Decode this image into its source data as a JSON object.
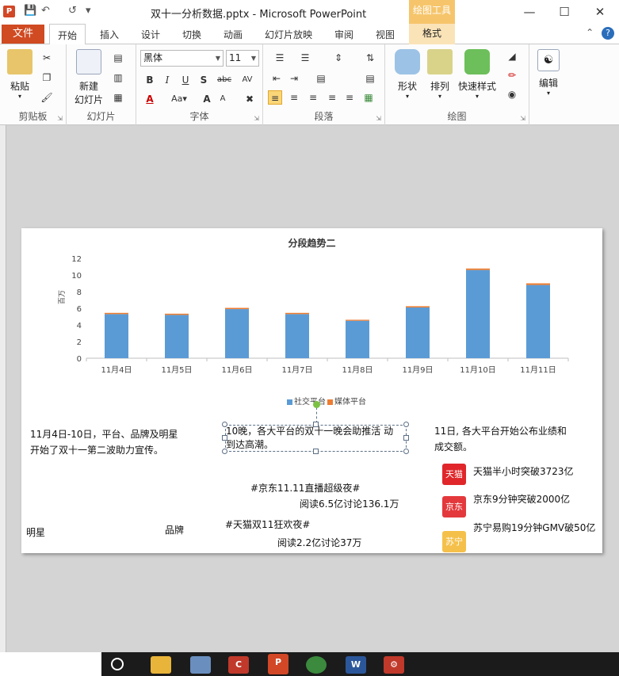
{
  "window": {
    "title": "双十一分析数据.pptx - Microsoft PowerPoint",
    "context_tab_header": "绘图工具"
  },
  "tabs": {
    "file": "文件",
    "items": [
      "开始",
      "插入",
      "设计",
      "切换",
      "动画",
      "幻灯片放映",
      "审阅",
      "视图"
    ],
    "context": "格式"
  },
  "ribbon": {
    "clipboard": {
      "paste": "粘贴",
      "group": "剪贴板"
    },
    "slides": {
      "new_slide": "新建",
      "new_slide2": "幻灯片",
      "group": "幻灯片"
    },
    "font": {
      "name": "黑体",
      "size": "11",
      "group": "字体"
    },
    "paragraph": {
      "group": "段落"
    },
    "drawing": {
      "shape": "形状",
      "arrange": "排列",
      "quick_style": "快速样式",
      "group": "绘图"
    },
    "editing": {
      "label": "编辑"
    }
  },
  "slide": {
    "note_left": "11月4日-10日，平台、品牌及明星开始了双十一第二波助力宣传。",
    "note_left_l1": "11月4日-10日，平台、品牌及明星",
    "note_left_l2": "开始了双十一第二波助力宣传。",
    "selected_text_l1": "10晚，各大平台的双十一晚会助推活 动",
    "selected_text_l2": "到达高潮。",
    "note_right_l1": "11日, 各大平台开始公布业绩和",
    "note_right_l2": "成交额。",
    "hashtag1": "#京东11.11直播超级夜#",
    "hashtag1_stats": "阅读6.5亿讨论136.1万",
    "hashtag2": "#天猫双11狂欢夜#",
    "hashtag2_stats": "阅读2.2亿讨论37万",
    "label_star": "明星",
    "label_brand": "品牌",
    "brands": [
      {
        "logo": "天猫",
        "text": "天猫半小时突破3723亿",
        "color": "#e0262a"
      },
      {
        "logo": "京东",
        "text": "京东9分钟突破2000亿",
        "color": "#e4393c"
      },
      {
        "logo": "苏宁",
        "text": "苏宁易购19分钟GMV破50亿",
        "color": "#f5c04a"
      }
    ]
  },
  "chart_data": {
    "type": "bar",
    "title": "分段趋势二",
    "ylabel": "百万",
    "ylim": [
      0,
      12
    ],
    "yticks": [
      "0",
      "2",
      "4",
      "6",
      "8",
      "10",
      "12"
    ],
    "categories": [
      "11月4日",
      "11月5日",
      "11月6日",
      "11月7日",
      "11月8日",
      "11月9日",
      "11月10日",
      "11月11日"
    ],
    "series": [
      {
        "name": "社交平台",
        "color": "#5b9bd5",
        "values": [
          5.3,
          5.2,
          5.9,
          5.3,
          4.5,
          6.1,
          10.6,
          8.8
        ]
      },
      {
        "name": "媒体平台",
        "color": "#ed7d31",
        "values": [
          0.15,
          0.15,
          0.15,
          0.15,
          0.12,
          0.15,
          0.18,
          0.2
        ]
      }
    ],
    "stacked": true,
    "legend_position": "bottom",
    "grid": false
  }
}
